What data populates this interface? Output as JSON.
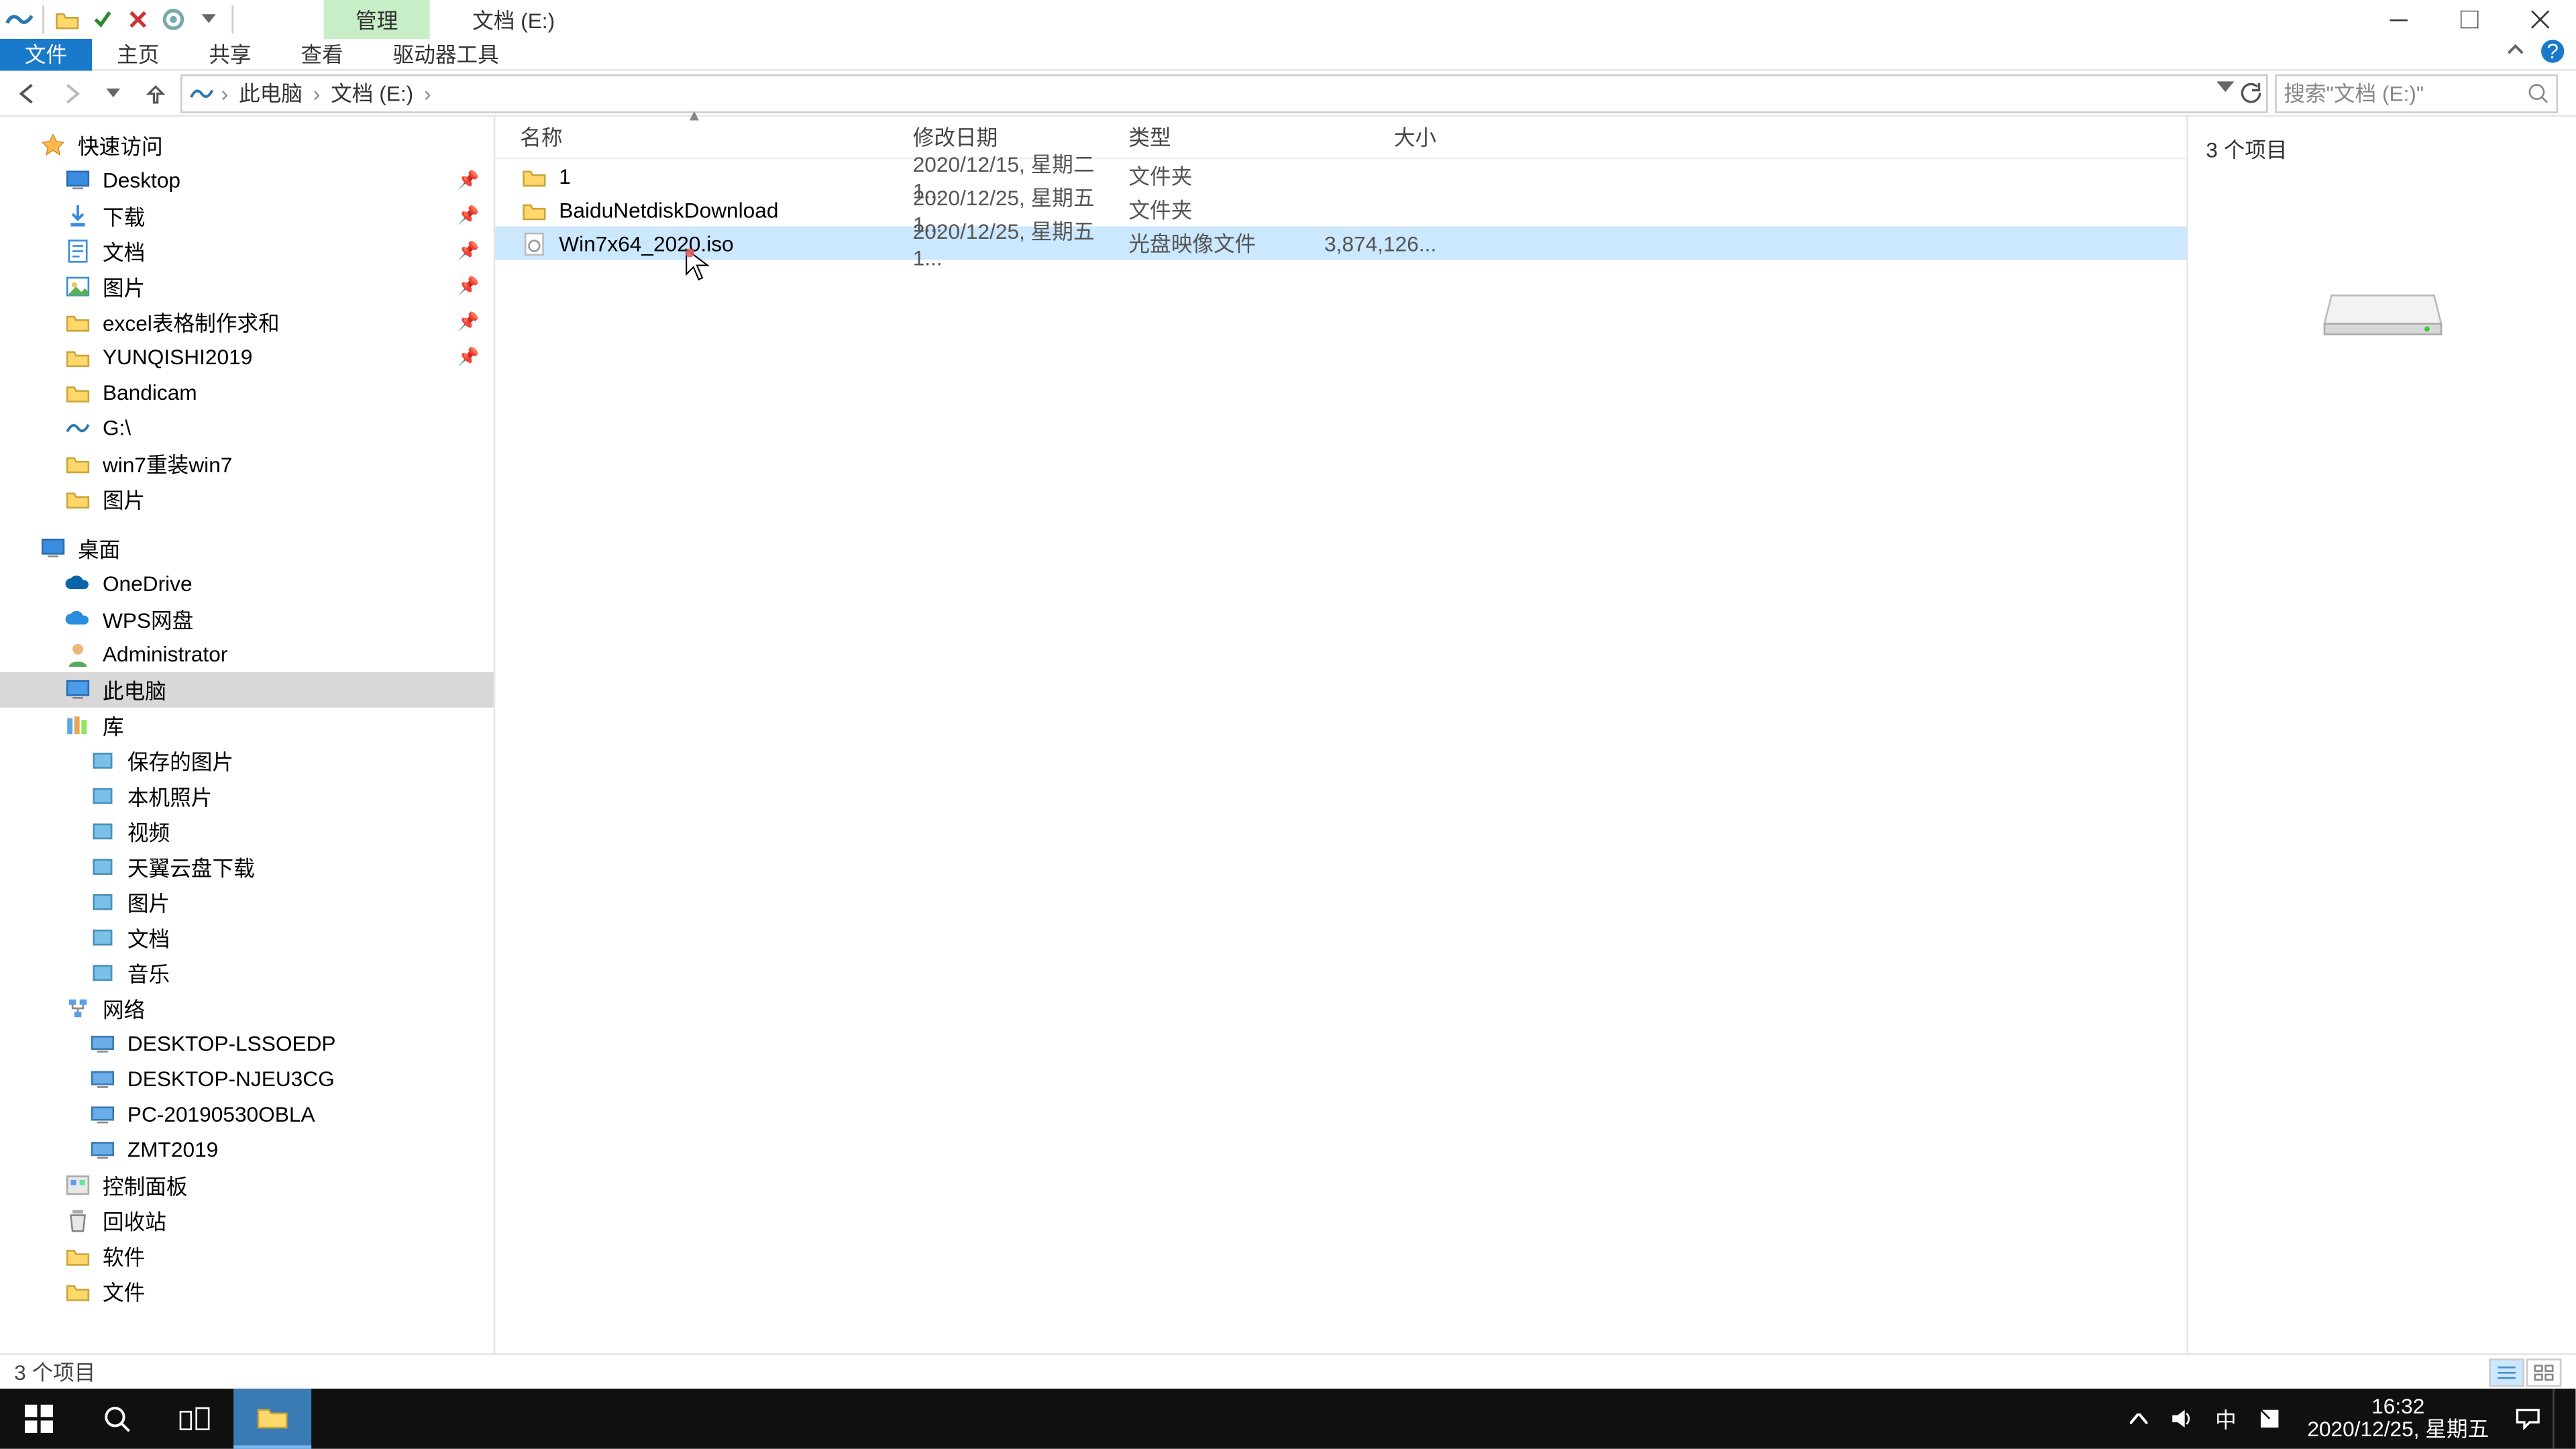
{
  "titlebar": {
    "manage_tab": "管理",
    "title": "文档 (E:)"
  },
  "ribbon": {
    "file": "文件",
    "home": "主页",
    "share": "共享",
    "view": "查看",
    "drive": "驱动器工具"
  },
  "breadcrumb": {
    "pc": "此电脑",
    "drive": "文档 (E:)"
  },
  "search": {
    "placeholder": "搜索\"文档 (E:)\""
  },
  "columns": {
    "name": "名称",
    "date": "修改日期",
    "type": "类型",
    "size": "大小"
  },
  "files": [
    {
      "name": "1",
      "date": "2020/12/15, 星期二 1...",
      "type": "文件夹",
      "size": "",
      "icon": "folder"
    },
    {
      "name": "BaiduNetdiskDownload",
      "date": "2020/12/25, 星期五 1...",
      "type": "文件夹",
      "size": "",
      "icon": "folder"
    },
    {
      "name": "Win7x64_2020.iso",
      "date": "2020/12/25, 星期五 1...",
      "type": "光盘映像文件",
      "size": "3,874,126...",
      "icon": "iso",
      "selected": true
    }
  ],
  "tree": {
    "quick": "快速访问",
    "quick_items": [
      {
        "label": "Desktop",
        "pin": true,
        "icon": "desktop"
      },
      {
        "label": "下载",
        "pin": true,
        "icon": "dl"
      },
      {
        "label": "文档",
        "pin": true,
        "icon": "doc"
      },
      {
        "label": "图片",
        "pin": true,
        "icon": "pic"
      },
      {
        "label": "excel表格制作求和",
        "pin": true,
        "icon": "folder"
      },
      {
        "label": "YUNQISHI2019",
        "pin": true,
        "icon": "folder"
      },
      {
        "label": "Bandicam",
        "pin": false,
        "icon": "folder"
      },
      {
        "label": "G:\\",
        "pin": false,
        "icon": "bird"
      },
      {
        "label": "win7重装win7",
        "pin": false,
        "icon": "folder"
      },
      {
        "label": "图片",
        "pin": false,
        "icon": "folder"
      }
    ],
    "desktop": "桌面",
    "onedrive": "OneDrive",
    "wps": "WPS网盘",
    "admin": "Administrator",
    "thispc": "此电脑",
    "libs": "库",
    "lib_items": [
      "保存的图片",
      "本机照片",
      "视频",
      "天翼云盘下载",
      "图片",
      "文档",
      "音乐"
    ],
    "network": "网络",
    "net_items": [
      "DESKTOP-LSSOEDP",
      "DESKTOP-NJEU3CG",
      "PC-20190530OBLA",
      "ZMT2019"
    ],
    "cpanel": "控制面板",
    "recycle": "回收站",
    "soft": "软件",
    "file_folder": "文件"
  },
  "preview": {
    "count": "3 个项目"
  },
  "status": {
    "text": "3 个项目"
  },
  "tray": {
    "time": "16:32",
    "date": "2020/12/25, 星期五",
    "ime": "中"
  }
}
